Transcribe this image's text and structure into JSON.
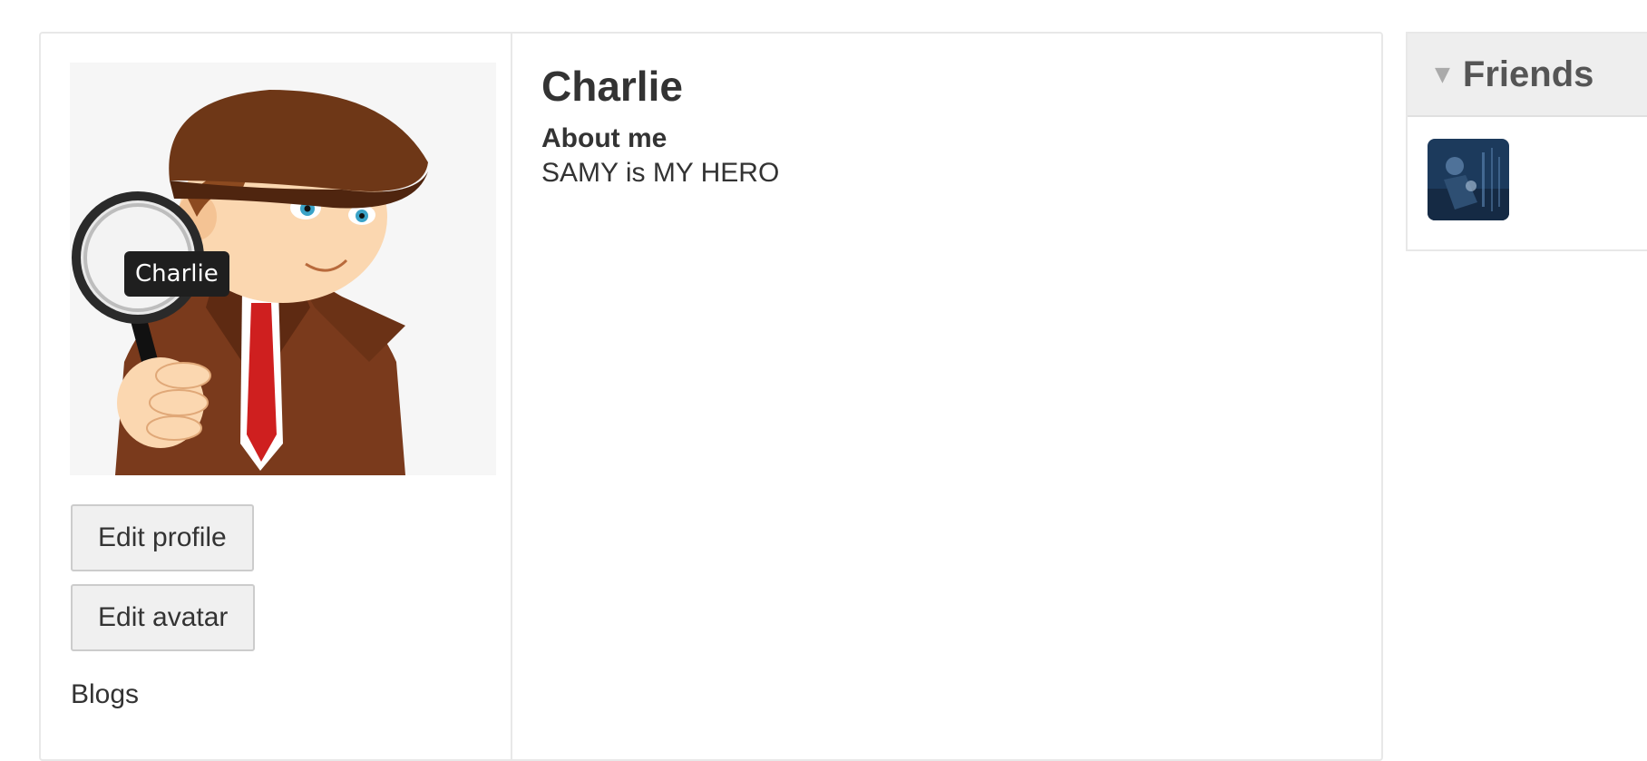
{
  "profile": {
    "name": "Charlie",
    "avatar_tooltip": "Charlie",
    "about_heading": "About me",
    "about_text": "SAMY is MY HERO"
  },
  "owner_actions": {
    "edit_profile_label": "Edit profile",
    "edit_avatar_label": "Edit avatar",
    "blogs_label": "Blogs"
  },
  "sidebar": {
    "friends_title": "Friends",
    "toggle_icon": "triangle-down-icon"
  },
  "colors": {
    "border": "#e8e8e8",
    "header_bg": "#eeeeee",
    "button_bg": "#f0f0f0",
    "text": "#333333"
  }
}
